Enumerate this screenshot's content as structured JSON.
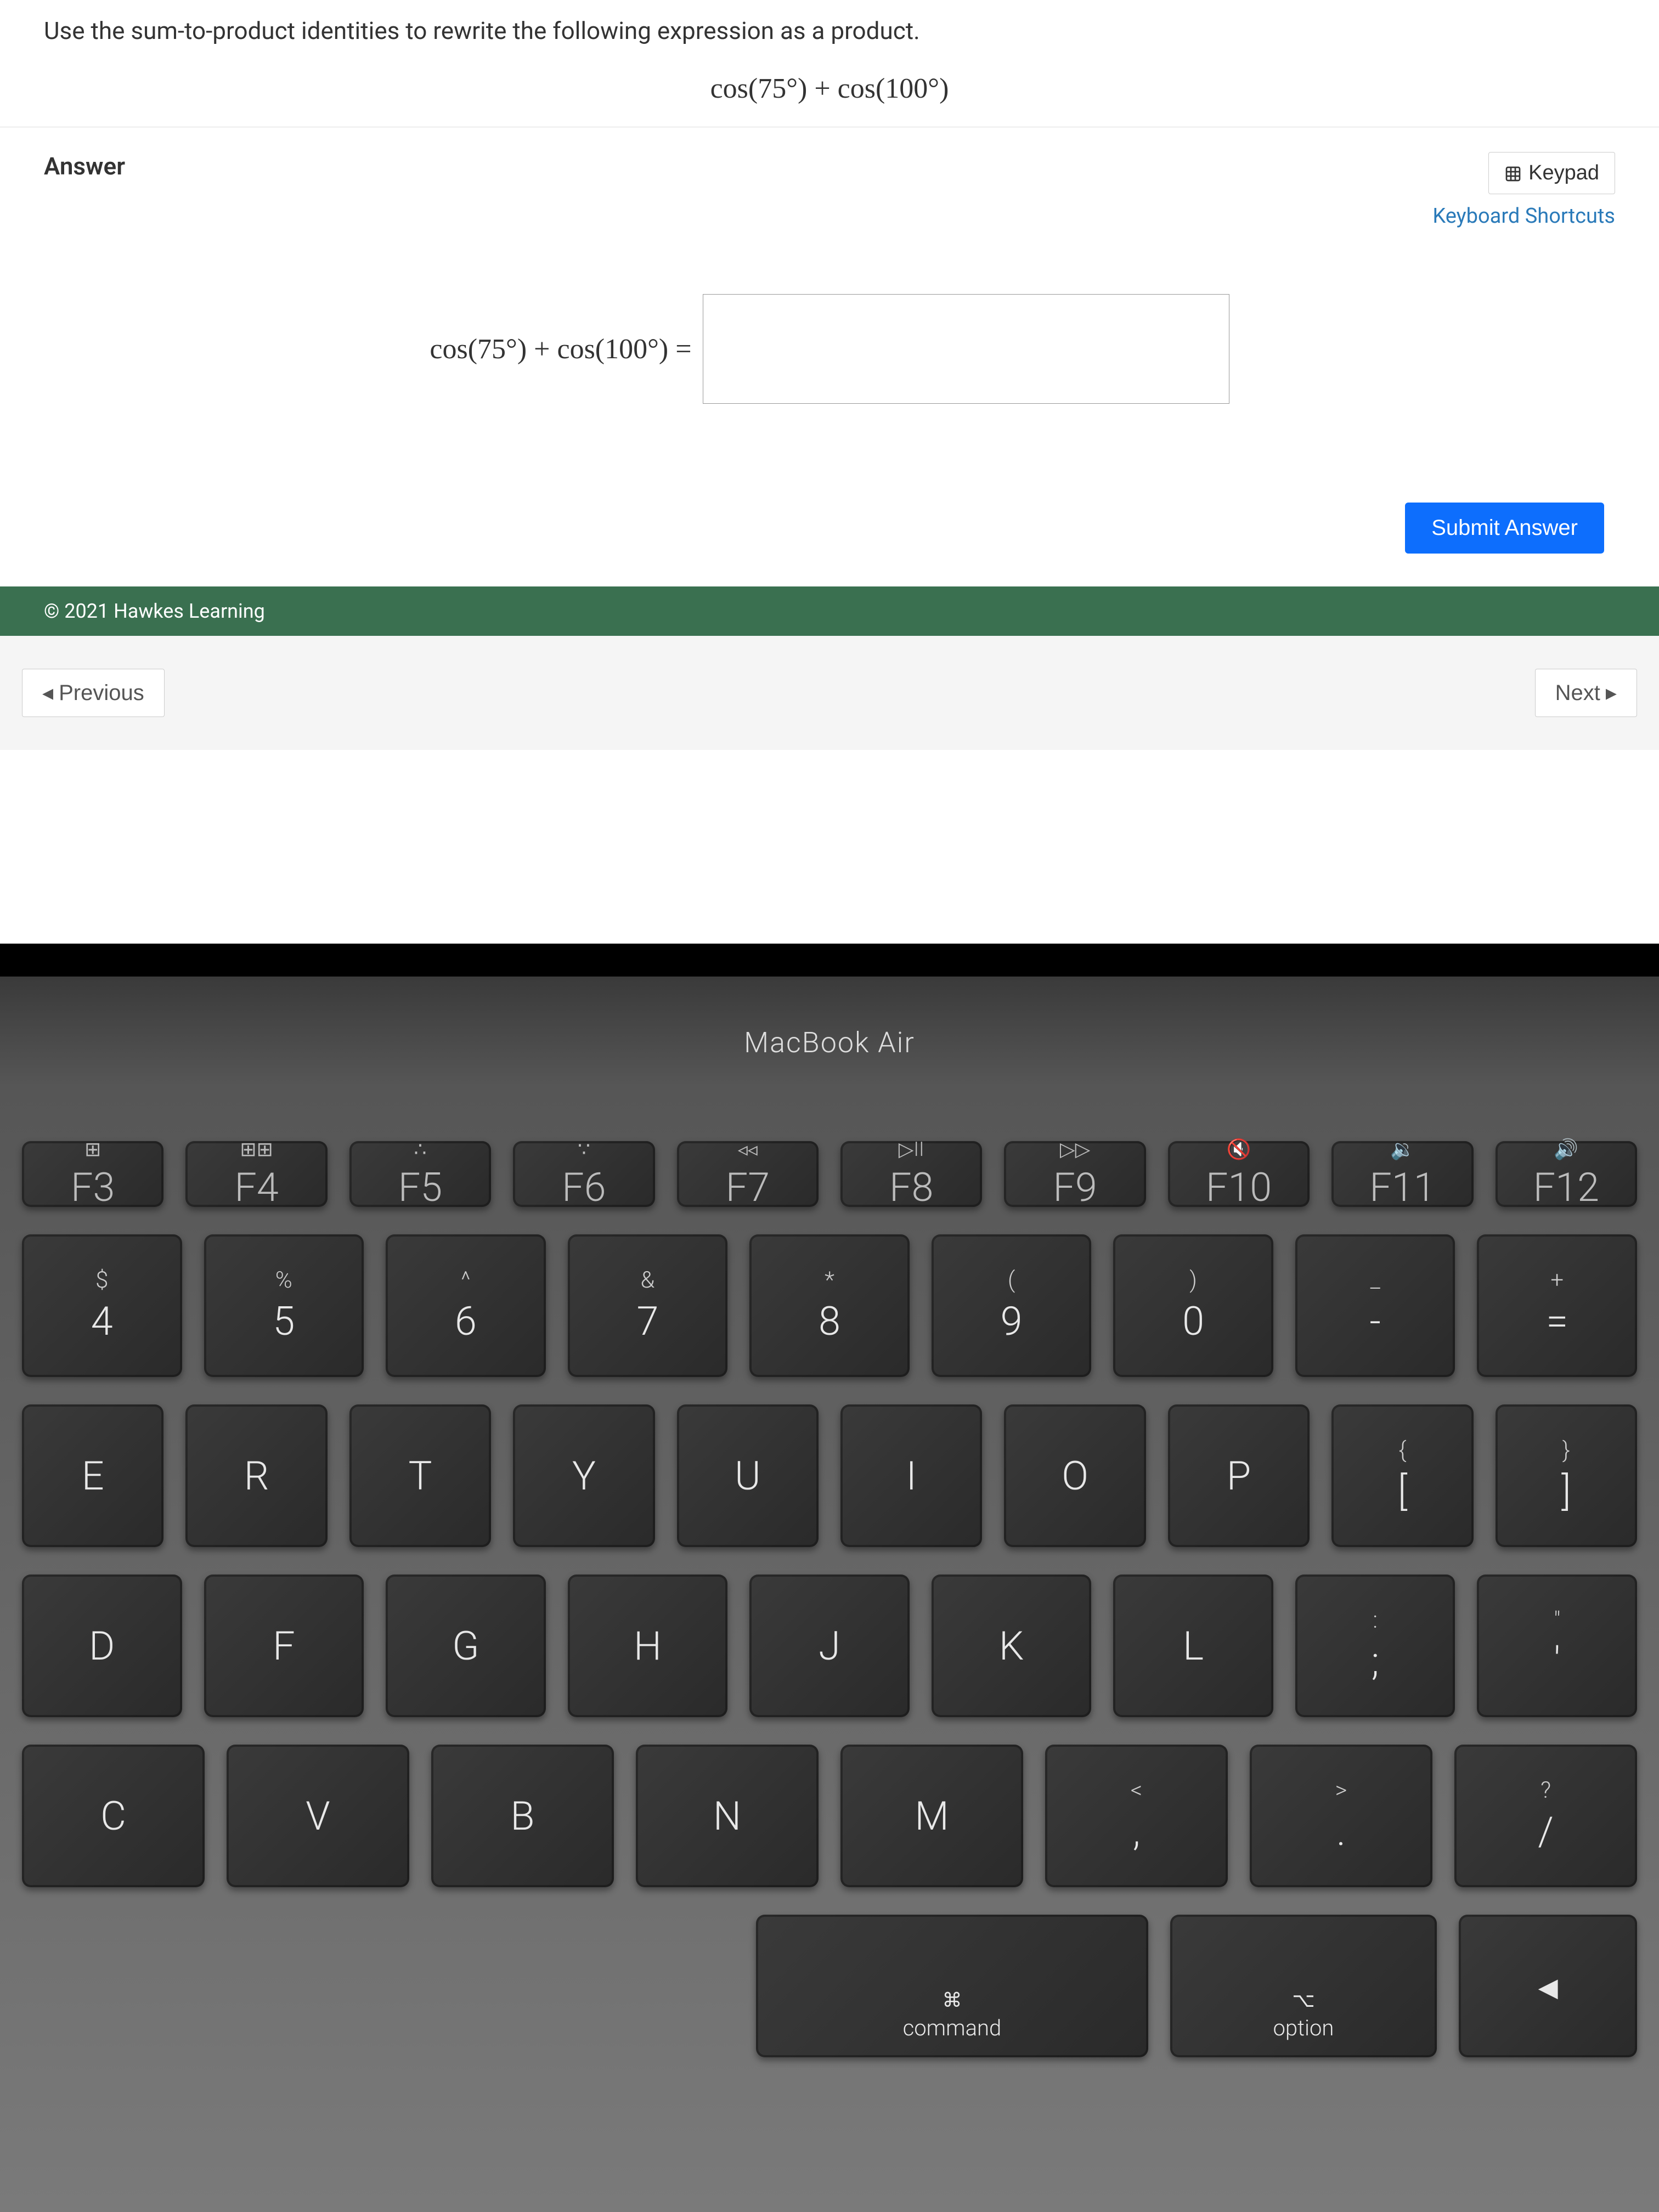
{
  "question": {
    "prompt": "Use the sum-to-product identities to rewrite the following expression as a product.",
    "expression": "cos(75°) + cos(100°)"
  },
  "answer": {
    "label": "Answer",
    "keypad_label": "Keypad",
    "shortcuts_label": "Keyboard Shortcuts",
    "lhs": "cos(75°) + cos(100°) =",
    "input_value": "",
    "submit_label": "Submit Answer"
  },
  "footer": {
    "copyright": "© 2021 Hawkes Learning"
  },
  "nav": {
    "previous": "Previous",
    "next": "Next"
  },
  "laptop": {
    "brand": "MacBook Air",
    "fn_keys": [
      {
        "icon": "⊞",
        "label": "F3"
      },
      {
        "icon": "⊞⊞",
        "label": "F4"
      },
      {
        "icon": "∴",
        "label": "F5"
      },
      {
        "icon": "∵",
        "label": "F6"
      },
      {
        "icon": "◃◃",
        "label": "F7"
      },
      {
        "icon": "▷II",
        "label": "F8"
      },
      {
        "icon": "▷▷",
        "label": "F9"
      },
      {
        "icon": "🔇",
        "label": "F10"
      },
      {
        "icon": "🔉",
        "label": "F11"
      },
      {
        "icon": "🔊",
        "label": "F12"
      }
    ],
    "num_row": [
      {
        "top": "$",
        "main": "4"
      },
      {
        "top": "%",
        "main": "5"
      },
      {
        "top": "^",
        "main": "6"
      },
      {
        "top": "&",
        "main": "7"
      },
      {
        "top": "*",
        "main": "8"
      },
      {
        "top": "(",
        "main": "9"
      },
      {
        "top": ")",
        "main": "0"
      },
      {
        "top": "_",
        "main": "-"
      },
      {
        "top": "+",
        "main": "="
      }
    ],
    "qwerty_row": [
      "R",
      "T",
      "Y",
      "U",
      "I",
      "O",
      "P"
    ],
    "bracket_keys": [
      {
        "top": "{",
        "main": "["
      },
      {
        "top": "}",
        "main": "]"
      }
    ],
    "asdf_row": [
      "F",
      "G",
      "H",
      "J",
      "K",
      "L"
    ],
    "semicolon": {
      "top": ":",
      "main": ";"
    },
    "quote": {
      "top": "\"",
      "main": "'"
    },
    "zxcv_row": [
      "C",
      "V",
      "B",
      "N",
      "M"
    ],
    "comma": {
      "top": "<",
      "main": ","
    },
    "period": {
      "top": ">",
      "main": "."
    },
    "slash": {
      "top": "?",
      "main": "/"
    },
    "mods": {
      "command_icon": "⌘",
      "command": "command",
      "option_icon": "⌥",
      "option": "option",
      "left_arrow": "◂"
    },
    "partial_left": {
      "e": "E",
      "d": "D"
    }
  }
}
